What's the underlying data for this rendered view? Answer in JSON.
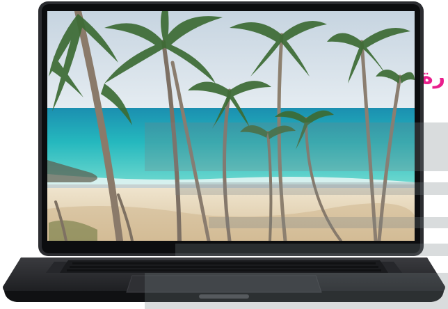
{
  "page": {
    "heading_fragment": "رة",
    "accent_color": "#e91e8c"
  },
  "device": {
    "type": "laptop",
    "screen_content": "beach-with-palm-trees-wallpaper",
    "body_color": "#2c2d30",
    "screen_bezel_color": "#0d0e10"
  },
  "colors": {
    "sky": "#cfdbe6",
    "sea": "#2ec4c4",
    "sand": "#e7d9bd",
    "overlay": "#7a8084"
  }
}
